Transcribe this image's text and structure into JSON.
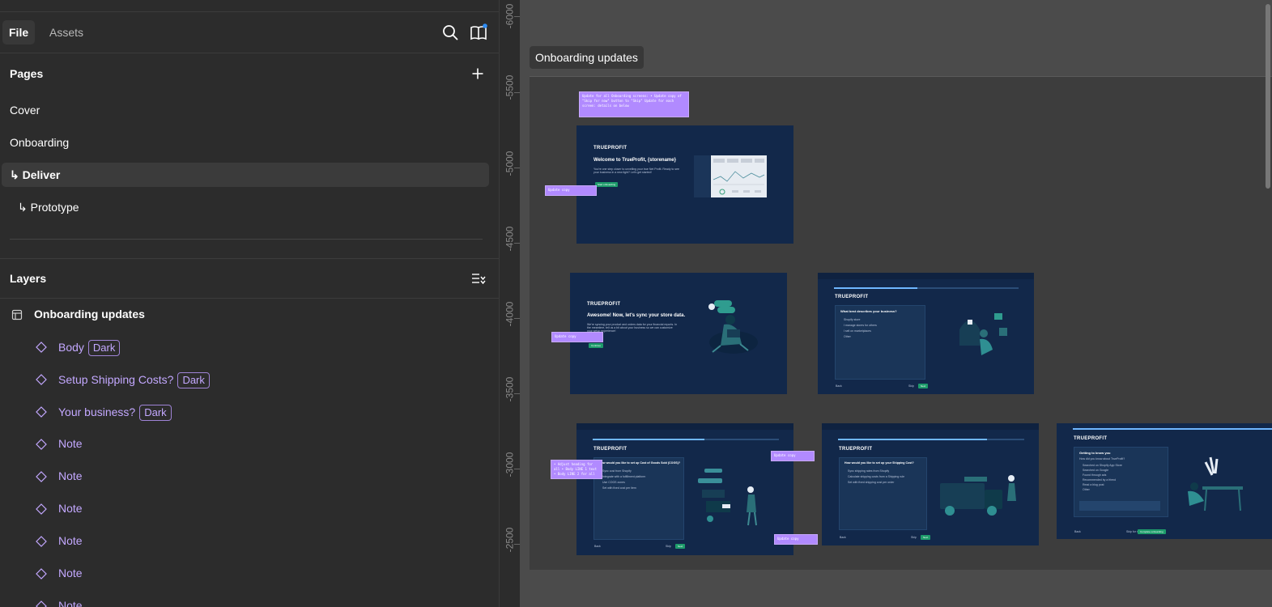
{
  "sidebar": {
    "tabs": [
      {
        "label": "File"
      },
      {
        "label": "Assets"
      }
    ],
    "header_icons": [
      "search-icon",
      "library-book-icon"
    ],
    "pages": {
      "title": "Pages",
      "add_icon": "plus-icon",
      "items": [
        {
          "label": "Cover"
        },
        {
          "label": "Onboarding"
        },
        {
          "label": "↳ Deliver"
        },
        {
          "label": "↳ Prototype"
        }
      ]
    },
    "layers": {
      "title": "Layers",
      "menu_icon": "layers-list-icon",
      "root": {
        "label": "Onboarding updates",
        "icon": "frame-icon"
      },
      "items": [
        {
          "label": "Body",
          "tag": "Dark"
        },
        {
          "label": "Setup Shipping Costs?",
          "tag": "Dark"
        },
        {
          "label": "Your business?",
          "tag": "Dark"
        },
        {
          "label": "Note",
          "tag": ""
        },
        {
          "label": "Note",
          "tag": ""
        },
        {
          "label": "Note",
          "tag": ""
        },
        {
          "label": "Note",
          "tag": ""
        },
        {
          "label": "Note",
          "tag": ""
        },
        {
          "label": "Note",
          "tag": ""
        }
      ]
    }
  },
  "ruler": {
    "labels": [
      "-6000",
      "-5500",
      "-5000",
      "-4500",
      "-4000",
      "-3500",
      "-3000",
      "-2500"
    ]
  },
  "canvas": {
    "frame_title": "Onboarding updates",
    "notes": {
      "top": "Update for all Onboarding screens: • Update copy of \"Skip for now\" button to \"Skip\" Update for each screen: details on below",
      "small_1": "Update copy",
      "small_2": "Update copy",
      "small_3": "• Adjust heading for all • Body LINE 1 text • Body LINE 2 for all",
      "small_4": "Update copy",
      "small_5": "Update copy"
    },
    "screens": {
      "welcome": {
        "logo": "TRUEPROFIT",
        "heading": "Welcome to TrueProfit, {storename}",
        "body": "You're one step closer to unveiling your true Net Profit. Ready to see your business in a new light? Let's get started!",
        "button": "Start onboarding"
      },
      "sync": {
        "logo": "TRUEPROFIT",
        "heading": "Awesome! Now, let's sync your store data.",
        "body": "We're syncing your product and orders data for your financial reports. In the meantime, tell us a bit about your business so we can customize your setup experience!",
        "button": "Continue"
      },
      "business": {
        "logo": "TRUEPROFIT",
        "heading": "What best describes your business?",
        "options": [
          "Shopify store",
          "I manage stores for others",
          "I sell on marketplaces",
          "Other"
        ],
        "back": "Back",
        "skip": "Skip",
        "next": "Next"
      },
      "cogs": {
        "logo": "TRUEPROFIT",
        "heading": "How would you like to set up Cost of Goods Sold (COGS)?",
        "options": [
          "Sync cost from Shopify",
          "Integrate with a fulfillment platform",
          "Use COGS zones",
          "Set with fixed cost per item"
        ],
        "back": "Back",
        "skip": "Skip",
        "next": "Next"
      },
      "shipping": {
        "logo": "TRUEPROFIT",
        "heading": "How would you like to set up your Shipping Cost?",
        "options": [
          "Sync shipping rates from Shopify",
          "Calculate shipping costs from a Shipping rule",
          "Set with fixed shipping cost per order"
        ],
        "back": "Back",
        "skip": "Skip",
        "next": "Next"
      },
      "about": {
        "logo": "TRUEPROFIT",
        "heading": "Getting to know you",
        "question": "How did you know about TrueProfit?",
        "options": [
          "Searched on Shopify App Store",
          "Searched on Google",
          "Found through ads",
          "Recommended by a friend",
          "Read a blog post",
          "Other"
        ],
        "back": "Back",
        "skip": "Skip for now",
        "next": "Complete onboarding"
      }
    }
  },
  "colors": {
    "panel_bg": "#2c2c2c",
    "canvas_bg": "#4b4b4b",
    "frame_bg": "#3d3d3d",
    "layer_text": "#c3a8ff",
    "note_bg": "#b18aff",
    "screen_bg": "#12284a",
    "accent_green": "#1e9c6b"
  }
}
